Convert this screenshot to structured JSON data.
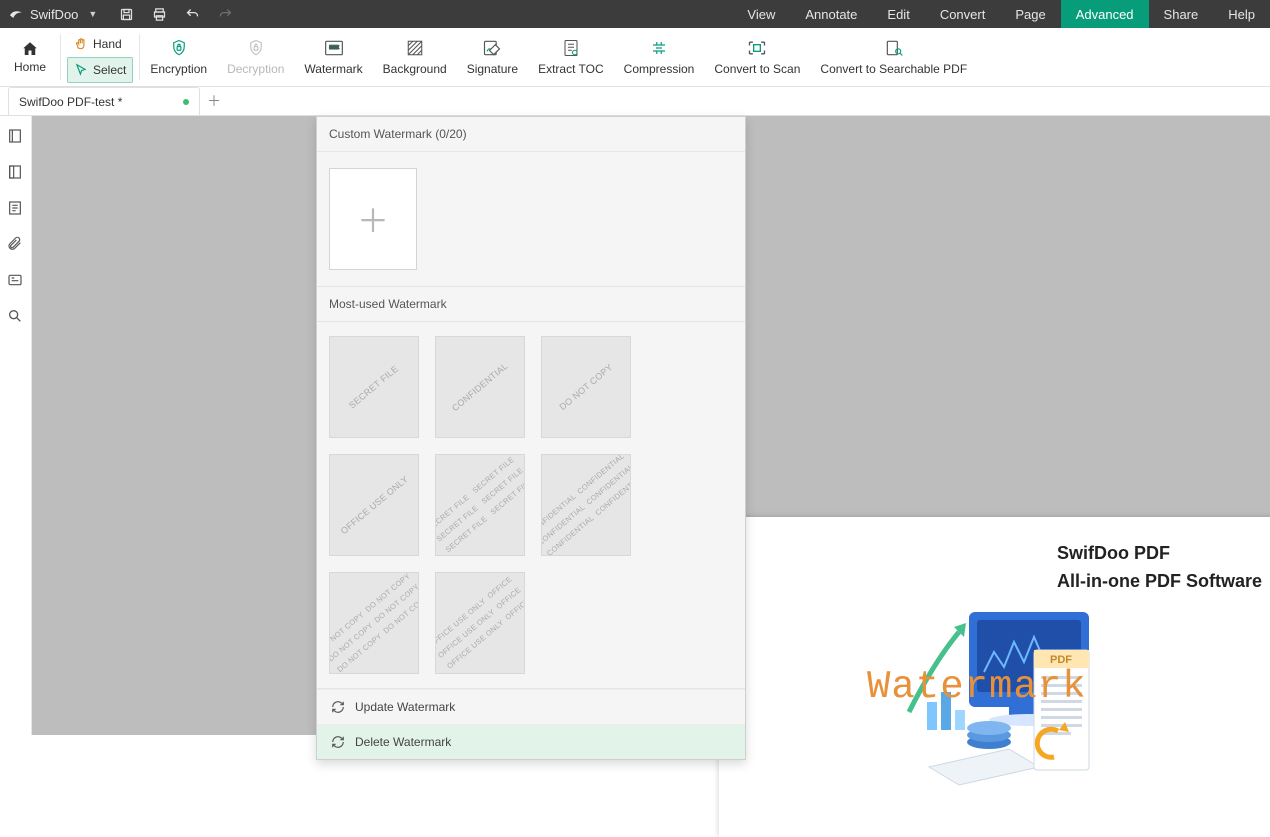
{
  "app": {
    "name": "SwifDoo"
  },
  "menus": {
    "view": "View",
    "annotate": "Annotate",
    "edit": "Edit",
    "convert": "Convert",
    "page": "Page",
    "advanced": "Advanced",
    "share": "Share",
    "help": "Help"
  },
  "ribbon": {
    "home": "Home",
    "hand": "Hand",
    "select": "Select",
    "encryption": "Encryption",
    "decryption": "Decryption",
    "watermark": "Watermark",
    "background": "Background",
    "signature": "Signature",
    "extract_toc": "Extract TOC",
    "compression": "Compression",
    "convert_to_scan": "Convert to Scan",
    "convert_to_searchable": "Convert to Searchable PDF"
  },
  "tab": {
    "name": "SwifDoo PDF-test *"
  },
  "panel": {
    "custom_heading": "Custom Watermark (0/20)",
    "mostused_heading": "Most-used Watermark",
    "update": "Update Watermark",
    "delete": "Delete Watermark",
    "presets": {
      "secret": "SECRET FILE",
      "confidential": "CONFIDENTIAL",
      "donotcopy": "DO NOT COPY",
      "office": "OFFICE USE ONLY"
    }
  },
  "document": {
    "line1": "SwifDoo PDF",
    "line2": "All-in-one PDF Software",
    "watermark": "Watermark",
    "pdf_label": "PDF"
  }
}
